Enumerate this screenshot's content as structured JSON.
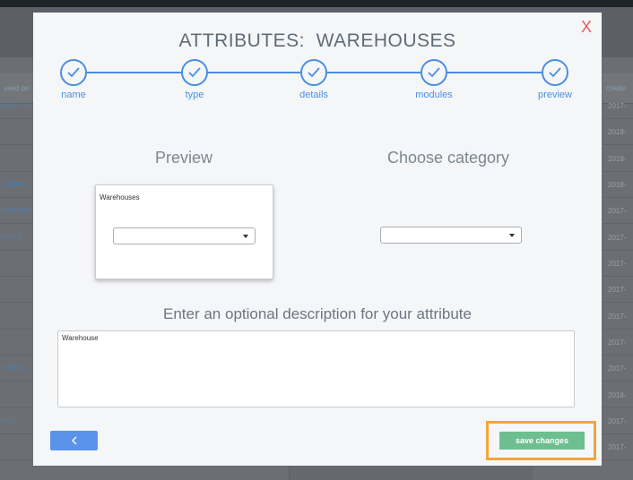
{
  "background": {
    "left_header": "used on -",
    "right_header": "create",
    "left_rows": [
      "labor, ma",
      "",
      "",
      "product",
      "customer",
      "vendor",
      "",
      "",
      "",
      "",
      "material",
      "",
      "ship",
      ""
    ],
    "right_rows": [
      "2017-",
      "2018-",
      "2018-",
      "2018-",
      "2017-",
      "2017-",
      "2017-",
      "2017-",
      "2017-",
      "2017-",
      "2017-",
      "2018-",
      "2017-",
      "2017-"
    ]
  },
  "modal": {
    "close_label": "X",
    "title": "ATTRIBUTES:  WAREHOUSES",
    "steps": [
      {
        "label": "name"
      },
      {
        "label": "type"
      },
      {
        "label": "details"
      },
      {
        "label": "modules"
      },
      {
        "label": "preview"
      }
    ],
    "preview_label": "Preview",
    "category_label": "Choose category",
    "preview_card_title": "Warehouses",
    "preview_select_value": "",
    "category_select_value": "",
    "description_label": "Enter an optional description for your attribute",
    "description_value": "Warehouse",
    "back_label": "<",
    "save_label": "save changes"
  },
  "colors": {
    "accent": "#4a8fe0",
    "save": "#6dbf8f",
    "highlight": "#f0a63a",
    "close": "#ef5a5a"
  },
  "icons": {
    "step": "check-circle-icon",
    "back": "chevron-left-icon",
    "dropdown": "caret-down-icon"
  }
}
